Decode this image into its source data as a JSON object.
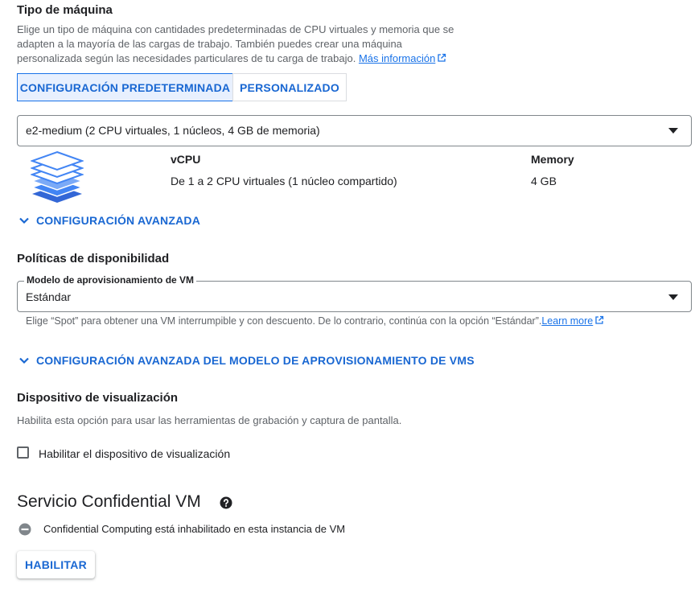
{
  "machine_type": {
    "title": "Tipo de máquina",
    "desc_line1": "Elige un tipo de máquina con cantidades predeterminadas de CPU virtuales y memoria que se",
    "desc_line2": "adapten a la mayoría de las cargas de trabajo. También puedes crear una máquina",
    "desc_line3": "personalizada según las necesidades particulares de tu carga de trabajo.",
    "more_info_link": "Más información",
    "tabs": [
      {
        "label": "CONFIGURACIÓN PREDETERMINADA",
        "selected": true
      },
      {
        "label": "PERSONALIZADO",
        "selected": false
      }
    ],
    "selected_machine": "e2-medium (2 CPU virtuales, 1 núcleos, 4 GB de memoria)",
    "vcpu_header": "vCPU",
    "vcpu_value": "De 1 a 2 CPU virtuales (1 núcleo compartido)",
    "memory_header": "Memory",
    "memory_value": "4 GB",
    "advanced_config": "CONFIGURACIÓN AVANZADA"
  },
  "availability": {
    "title": "Políticas de disponibilidad",
    "provisioning_label": "Modelo de aprovisionamiento de VM",
    "provisioning_value": "Estándar",
    "hint": "Elige “Spot” para obtener una VM interrumpible y con descuento. De lo contrario, continúa con la opción “Estándar”.",
    "learn_more": "Learn more",
    "advanced_provisioning": "CONFIGURACIÓN AVANZADA DEL MODELO DE APROVISIONAMIENTO DE VMS"
  },
  "display_device": {
    "title": "Dispositivo de visualización",
    "desc": "Habilita esta opción para usar las herramientas de grabación y captura de pantalla.",
    "checkbox_label": "Habilitar el dispositivo de visualización",
    "checked": false
  },
  "confidential": {
    "title": "Servicio Confidential VM",
    "status": "Confidential Computing está inhabilitado en esta instancia de VM",
    "enable_button": "HABILITAR"
  },
  "colors": {
    "accent": "#1a73e8",
    "accent_text": "#1967d2",
    "selected_tab_bg": "#e8f0fe"
  }
}
